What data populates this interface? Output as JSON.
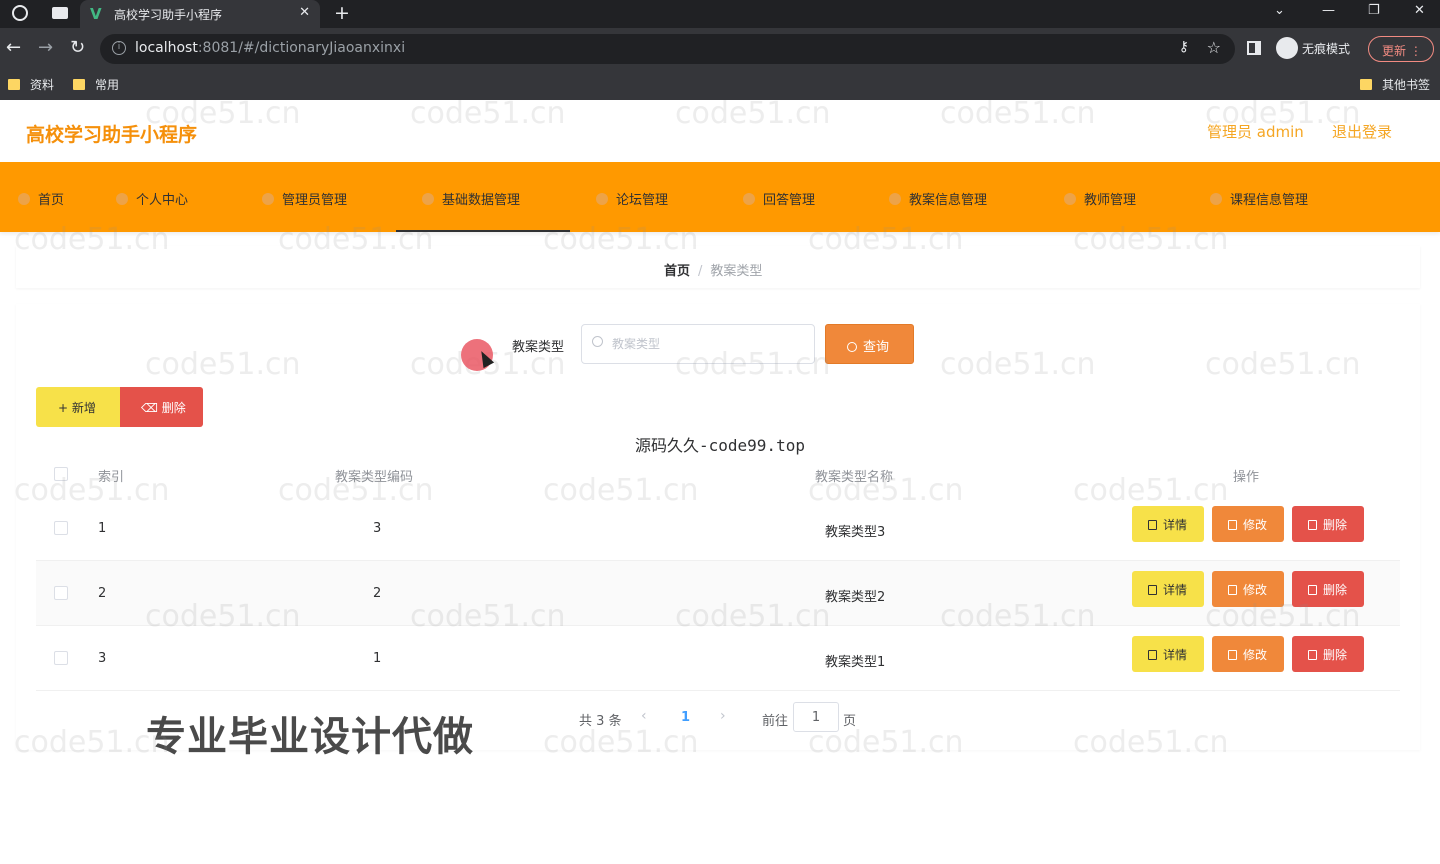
{
  "browser": {
    "tab_title": "高校学习助手小程序",
    "tab_close": "✕",
    "new_tab": "+",
    "url_host": "localhost",
    "url_rest": ":8081/#/dictionaryJiaoanxinxi",
    "incognito_label": "无痕模式",
    "update_label": "更新 ⋮",
    "bookmarks": [
      "资料",
      "常用"
    ],
    "other_bookmarks": "其他书签"
  },
  "header": {
    "title": "高校学习助手小程序",
    "admin": "管理员 admin",
    "logout": "退出登录"
  },
  "nav": {
    "items": [
      "首页",
      "个人中心",
      "管理员管理",
      "基础数据管理",
      "论坛管理",
      "回答管理",
      "教案信息管理",
      "教师管理",
      "课程信息管理"
    ],
    "active": "基础数据管理"
  },
  "breadcrumb": {
    "home": "首页",
    "separator": "/",
    "current": "教案类型"
  },
  "search": {
    "label": "教案类型",
    "placeholder": "教案类型",
    "button": "查询"
  },
  "actions": {
    "add": "+ 新增",
    "delete": "删除"
  },
  "overlay_text": "源码久久-code99.top",
  "table": {
    "headers": [
      "索引",
      "教案类型编码",
      "教案类型名称",
      "操作"
    ],
    "rows": [
      {
        "index": "1",
        "code": "3",
        "name": "教案类型3"
      },
      {
        "index": "2",
        "code": "2",
        "name": "教案类型2"
      },
      {
        "index": "3",
        "code": "1",
        "name": "教案类型1"
      }
    ],
    "row_actions": {
      "detail": "详情",
      "edit": "修改",
      "delete": "删除"
    }
  },
  "pagination": {
    "total": "共 3 条",
    "prev": "‹",
    "current_page": "1",
    "next": "›",
    "goto_label": "前往",
    "goto_value": "1",
    "page_unit": "页"
  },
  "promo_text": "专业毕业设计代做",
  "watermark": "code51.cn",
  "colors": {
    "nav_bg": "#ff9900",
    "title": "#f5900b",
    "query_button": "#f0883a",
    "add_button": "#f7e149",
    "delete_button": "#e4524a",
    "active_page": "#409eff"
  }
}
